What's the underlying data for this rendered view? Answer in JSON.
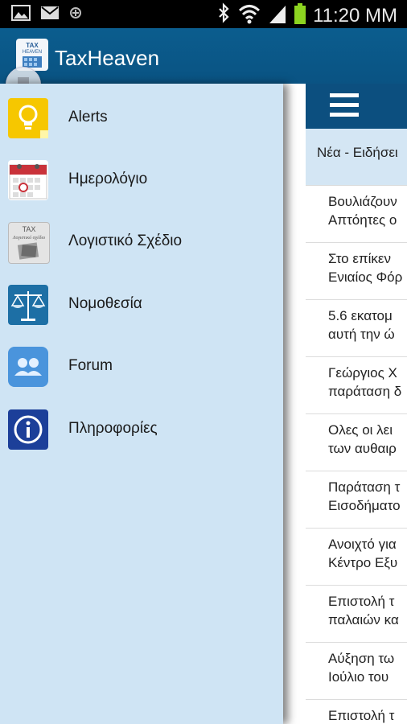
{
  "status_bar": {
    "time": "11:20 MM"
  },
  "app_bar": {
    "title": "TaxHeaven",
    "logo_text": "TAX HEAVEN"
  },
  "drawer": {
    "items": [
      {
        "label": "Alerts",
        "icon": "lightbulb-icon"
      },
      {
        "label": "Ημερολόγιο",
        "icon": "calendar-icon"
      },
      {
        "label": "Λογιστικό Σχέδιο",
        "icon": "accounting-plan-icon"
      },
      {
        "label": "Νομοθεσία",
        "icon": "scales-icon"
      },
      {
        "label": "Forum",
        "icon": "forum-icon"
      },
      {
        "label": "Πληροφορίες",
        "icon": "info-icon"
      }
    ],
    "accounting_icon_text": "TAX",
    "accounting_icon_sub": "Λογιστικό σχέδιο"
  },
  "content": {
    "section_title": "Νέα - Ειδήσει",
    "news": [
      {
        "line1": "Βουλιάζουν",
        "line2": "Απτόητες ο"
      },
      {
        "line1": "Στο επίκεν",
        "line2": "Ενιαίος Φόρ"
      },
      {
        "line1": "5.6 εκατομ",
        "line2": "αυτή την ώ"
      },
      {
        "line1": "Γεώργιος Χ",
        "line2": "παράταση δ"
      },
      {
        "line1": "Ολες οι λει",
        "line2": "των αυθαιρ"
      },
      {
        "line1": "Παράταση τ",
        "line2": "Εισοδήματο"
      },
      {
        "line1": "Ανοιχτό για",
        "line2": "Κέντρο Εξυ"
      },
      {
        "line1": "Επιστολή τ",
        "line2": "παλαιών κα"
      },
      {
        "line1": "Αύξηση τω",
        "line2": "Ιούλιο του"
      },
      {
        "line1": "Επιστολή τ",
        "line2": ""
      }
    ]
  },
  "colors": {
    "app_bar": "#0a5383",
    "drawer_bg": "#cfe4f4",
    "section_bg": "#d4e6f4",
    "toolbar": "#0c4f7f"
  }
}
